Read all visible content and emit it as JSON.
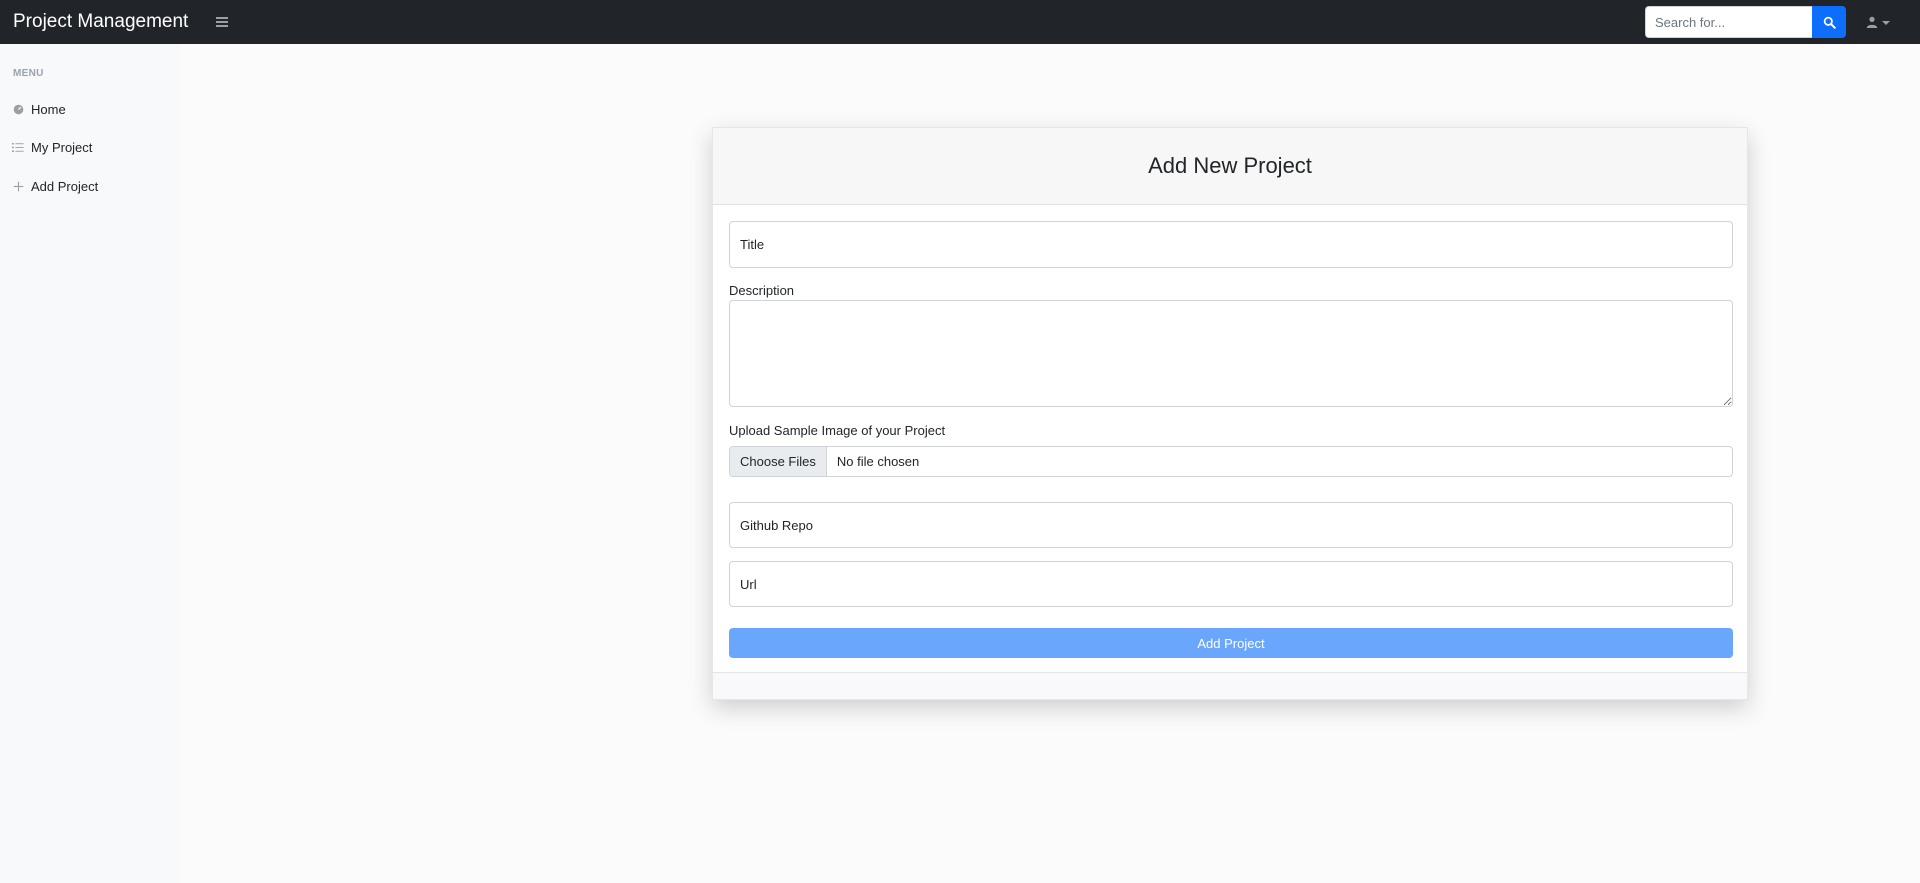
{
  "app": {
    "brand": "Project Management"
  },
  "search": {
    "placeholder": "Search for..."
  },
  "sidebar": {
    "heading": "MENU",
    "items": [
      {
        "label": "Home",
        "icon": "gauge-icon"
      },
      {
        "label": "My Project",
        "icon": "list-icon"
      },
      {
        "label": "Add Project",
        "icon": "plus-icon"
      }
    ]
  },
  "form": {
    "title": "Add New Project",
    "title_placeholder": "Title",
    "description_label": "Description",
    "image_label": "Upload Sample Image of your Project",
    "file_button": "Choose Files",
    "file_status": "No file chosen",
    "github_placeholder": "Github Repo",
    "url_placeholder": "Url",
    "submit_label": "Add Project"
  },
  "colors": {
    "navbar": "#212529",
    "primary": "#0d6efd",
    "submit": "#6ba6fd"
  }
}
